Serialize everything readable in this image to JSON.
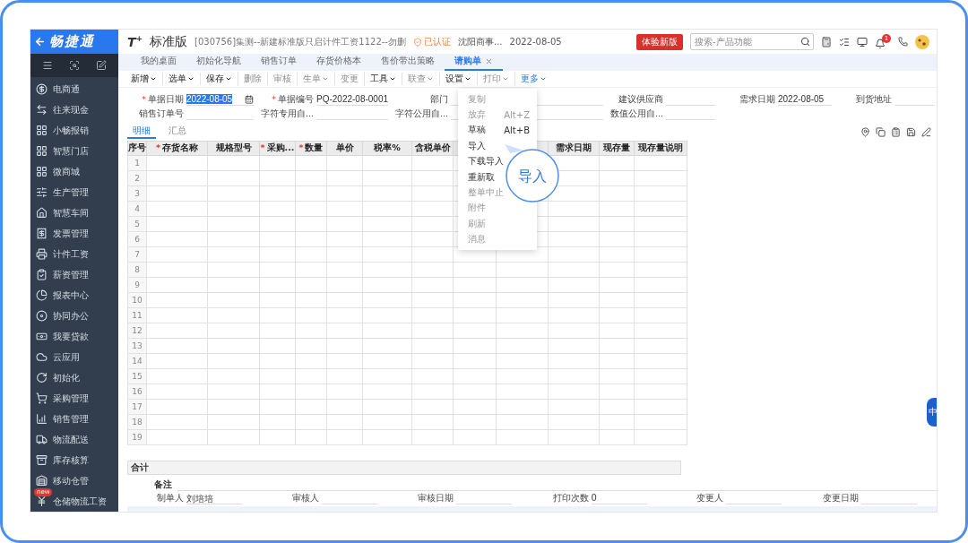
{
  "sidebar": {
    "logo": "畅捷通",
    "items": [
      {
        "label": "电商通"
      },
      {
        "label": "往来现金"
      },
      {
        "label": "小畅报销"
      },
      {
        "label": "智慧门店"
      },
      {
        "label": "微商城"
      },
      {
        "label": "生产管理"
      },
      {
        "label": "智慧车间"
      },
      {
        "label": "发票管理"
      },
      {
        "label": "计件工资"
      },
      {
        "label": "薪资管理"
      },
      {
        "label": "报表中心"
      },
      {
        "label": "协同办公"
      },
      {
        "label": "我要贷款"
      },
      {
        "label": "云应用"
      },
      {
        "label": "初始化"
      },
      {
        "label": "采购管理"
      },
      {
        "label": "销售管理"
      },
      {
        "label": "物流配送"
      },
      {
        "label": "库存核算"
      },
      {
        "label": "移动仓管"
      },
      {
        "label": "仓储物流工资",
        "badge": "new"
      }
    ]
  },
  "header": {
    "logo": "T$^{+}$",
    "edition": "标准版",
    "account": "[030756]集测--新建标准版只启计件工资1122--勿删",
    "certified": "已认证",
    "company": "沈阳商事...",
    "date": "2022-08-05",
    "new_version_button": "体验新版",
    "search_placeholder": "搜索-产品功能",
    "notification_count": "1"
  },
  "tabs": [
    {
      "label": "我的桌面",
      "selected": false
    },
    {
      "label": "初始化导航",
      "selected": false
    },
    {
      "label": "销售订单",
      "selected": false
    },
    {
      "label": "存货价格本",
      "selected": false
    },
    {
      "label": "售价带出策略",
      "selected": false
    },
    {
      "label": "请购单",
      "selected": true
    }
  ],
  "toolbar": [
    {
      "label": "新增",
      "dropdown": true,
      "disabled": false,
      "open": false
    },
    {
      "label": "选单",
      "dropdown": true,
      "disabled": false,
      "open": false
    },
    {
      "label": "保存",
      "dropdown": true,
      "disabled": false,
      "open": false
    },
    {
      "label": "删除",
      "dropdown": false,
      "disabled": true,
      "open": false
    },
    {
      "label": "审核",
      "dropdown": false,
      "disabled": true,
      "open": false
    },
    {
      "label": "生单",
      "dropdown": true,
      "disabled": true,
      "open": false
    },
    {
      "label": "变更",
      "dropdown": false,
      "disabled": true,
      "open": false
    },
    {
      "label": "工具",
      "dropdown": true,
      "disabled": false,
      "open": false
    },
    {
      "label": "联查",
      "dropdown": true,
      "disabled": true,
      "open": false
    },
    {
      "label": "设置",
      "dropdown": true,
      "disabled": false,
      "open": false
    },
    {
      "label": "打印",
      "dropdown": true,
      "disabled": true,
      "open": false
    },
    {
      "label": "更多",
      "dropdown": true,
      "disabled": false,
      "open": true
    }
  ],
  "form": {
    "rows": [
      [
        {
          "label": "单据日期",
          "required": true,
          "value": "2022-08-05",
          "highlighted": true,
          "calendar": true
        },
        {
          "label": "单据编号",
          "required": true,
          "value": "PQ-2022-08-0001"
        },
        {
          "label": "部门",
          "required": false
        },
        {
          "label": "建议供应商",
          "required": false
        },
        {
          "label": "需求日期",
          "required": false,
          "value": "2022-08-05"
        },
        {
          "label": "到货地址",
          "required": false
        }
      ],
      [
        {
          "label": "销售订单号",
          "required": false
        },
        {
          "label": "字符专用自...",
          "required": false
        },
        {
          "label": "字符公用自...",
          "required": false
        },
        {
          "label": "数值公用自...",
          "required": false
        }
      ]
    ]
  },
  "detail_tabs": [
    {
      "label": "明细",
      "selected": true
    },
    {
      "label": "汇总",
      "selected": false
    }
  ],
  "table": {
    "columns": [
      {
        "label": "序号",
        "required": false
      },
      {
        "label": "存货名称",
        "required": true
      },
      {
        "label": "规格型号",
        "required": false
      },
      {
        "label": "采购...",
        "required": true
      },
      {
        "label": "数量",
        "required": true
      },
      {
        "label": "单价",
        "required": false
      },
      {
        "label": "税率%",
        "required": false
      },
      {
        "label": "含税单价",
        "required": false
      },
      {},
      {},
      {
        "label": "需求日期",
        "required": false
      },
      {
        "label": "现存量",
        "required": false
      },
      {
        "label": "现存量说明",
        "required": false
      }
    ],
    "rows": [
      {
        "number": "1"
      },
      {
        "number": "2"
      },
      {
        "number": "3"
      },
      {
        "number": "4"
      },
      {
        "number": "5"
      },
      {
        "number": "6"
      },
      {
        "number": "7"
      },
      {
        "number": "8"
      },
      {
        "number": "9"
      },
      {
        "number": "10"
      },
      {
        "number": "11"
      },
      {
        "number": "12"
      },
      {
        "number": "13"
      },
      {
        "number": "14"
      },
      {
        "number": "15"
      },
      {
        "number": "16"
      },
      {
        "number": "17"
      },
      {
        "number": "18"
      },
      {
        "number": "19"
      }
    ]
  },
  "totals_label": "合计",
  "remarks_label": "备注",
  "footer_fields": [
    {
      "label": "制单人",
      "value": "刘培培"
    },
    {
      "label": "审核人"
    },
    {
      "label": "审核日期"
    },
    {
      "label": "打印次数",
      "value": "0"
    },
    {
      "label": "变更人"
    },
    {
      "label": "变更日期"
    }
  ],
  "more_menu": {
    "items": [
      {
        "label": "复制",
        "disabled": true
      },
      {
        "label": "放弃",
        "shortcut": "Alt+Z",
        "disabled": true
      },
      {
        "label": "草稿",
        "shortcut": "Alt+B",
        "disabled": false
      },
      {
        "label": "导入",
        "disabled": false
      },
      {
        "label": "下载导入",
        "disabled": false
      },
      {
        "label": "重新取",
        "disabled": false
      },
      {
        "label": "整单中止",
        "disabled": true
      },
      {
        "label": "附件",
        "disabled": true
      },
      {
        "label": "刷新",
        "disabled": true
      },
      {
        "label": "消息",
        "disabled": true
      }
    ],
    "callout": "导入"
  },
  "floating_tab": "中",
  "required_mark": "*"
}
